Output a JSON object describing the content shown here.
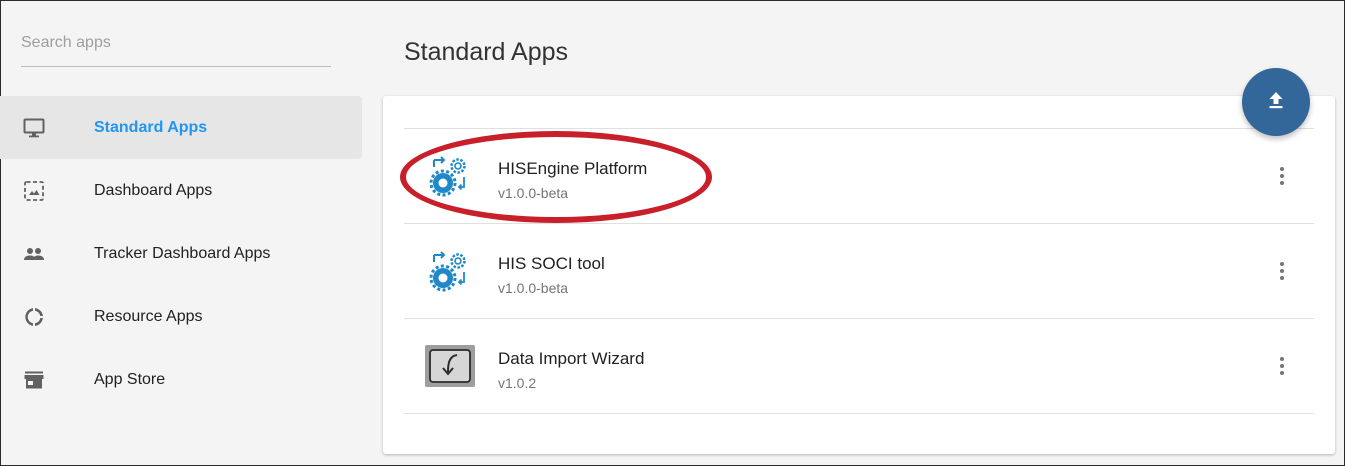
{
  "search": {
    "placeholder": "Search apps",
    "value": ""
  },
  "sidebar": {
    "items": [
      {
        "label": "Standard Apps",
        "icon": "monitor-icon",
        "active": true
      },
      {
        "label": "Dashboard Apps",
        "icon": "dashboard-icon",
        "active": false
      },
      {
        "label": "Tracker Dashboard Apps",
        "icon": "people-icon",
        "active": false
      },
      {
        "label": "Resource Apps",
        "icon": "donut-icon",
        "active": false
      },
      {
        "label": "App Store",
        "icon": "store-icon",
        "active": false
      }
    ]
  },
  "main": {
    "title": "Standard Apps",
    "apps": [
      {
        "name": "HISEngine Platform",
        "version": "v1.0.0-beta",
        "icon": "gears-icon"
      },
      {
        "name": "HIS SOCI tool",
        "version": "v1.0.0-beta",
        "icon": "gears-icon"
      },
      {
        "name": "Data Import Wizard",
        "version": "v1.0.2",
        "icon": "import-wizard-icon"
      }
    ]
  },
  "fab": {
    "icon": "upload-icon"
  },
  "colors": {
    "accent": "#2196f3",
    "fab": "#336699",
    "highlight": "#c8202a",
    "icon_blue": "#1e88c8"
  }
}
